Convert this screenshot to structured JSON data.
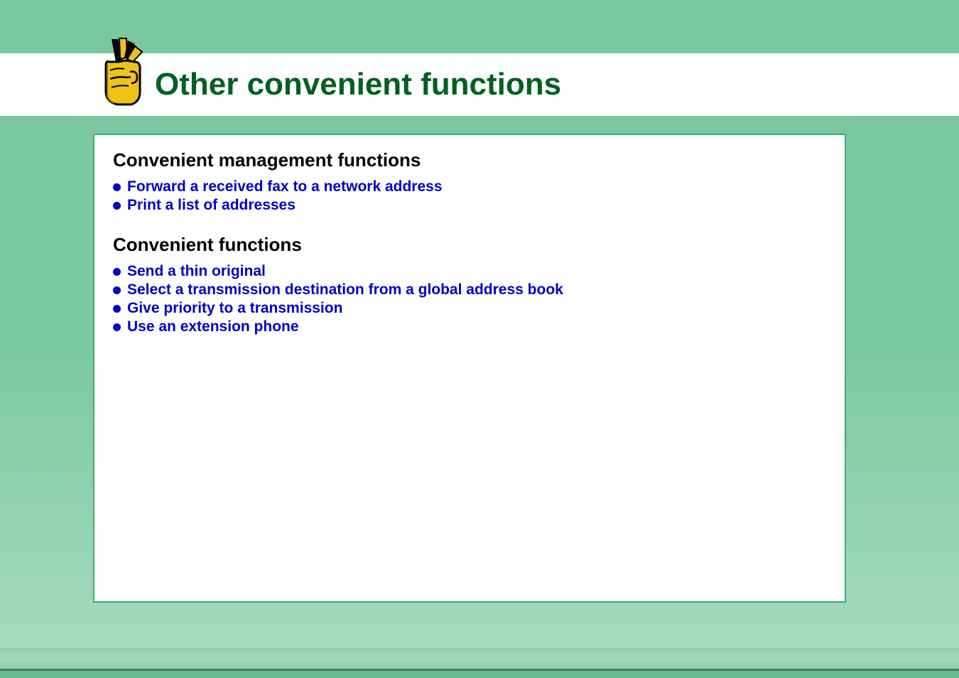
{
  "header": {
    "title": "Other convenient functions"
  },
  "sections": [
    {
      "title": "Convenient management functions",
      "links": [
        "Forward a received fax to a network address",
        "Print a list of addresses"
      ]
    },
    {
      "title": "Convenient functions",
      "links": [
        "Send a thin original",
        "Select a transmission destination from a global address book",
        "Give priority to a transmission",
        "Use an extension phone"
      ]
    }
  ]
}
